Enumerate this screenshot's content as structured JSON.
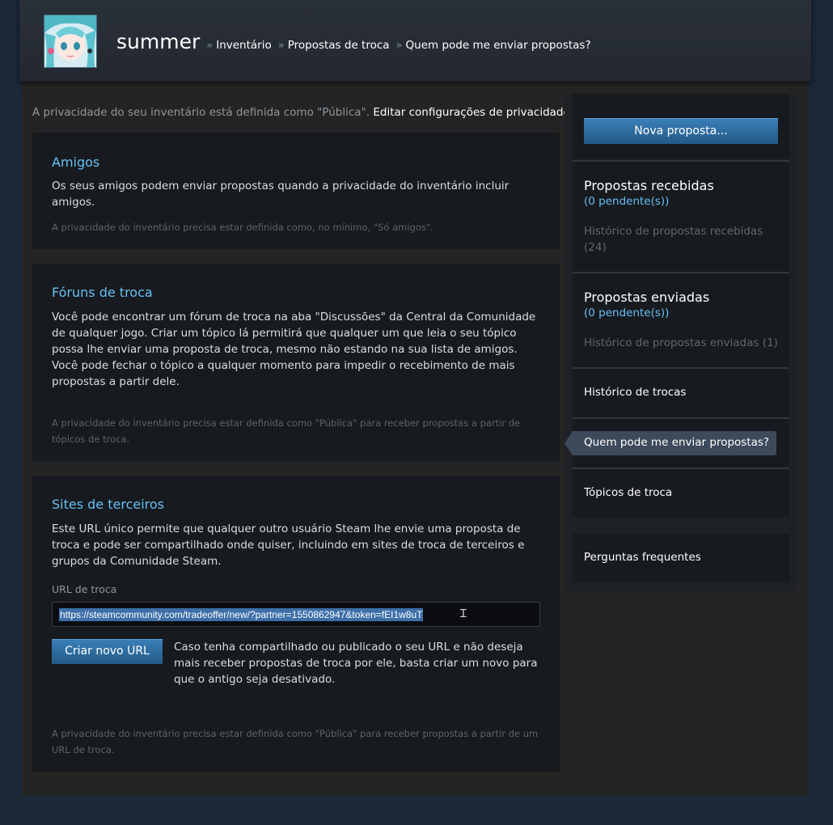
{
  "header": {
    "username": "summer",
    "breadcrumb": {
      "sep": "»",
      "items": [
        "Inventário",
        "Propostas de troca",
        "Quem pode me enviar propostas?"
      ]
    }
  },
  "privacy": {
    "text": "A privacidade do seu inventário está definida como \"Pública\".",
    "link": "Editar configurações de privacidade"
  },
  "friends": {
    "title": "Amigos",
    "text": "Os seus amigos podem enviar propostas quando a privacidade do inventário incluir amigos.",
    "note": "A privacidade do inventário precisa estar definida como, no mínimo, \"Só amigos\"."
  },
  "forums": {
    "title": "Fóruns de troca",
    "text": "Você pode encontrar um fórum de troca na aba \"Discussões\" da Central da Comunidade de qualquer jogo. Criar um tópico lá permitirá que qualquer um que leia o seu tópico possa lhe enviar uma proposta de troca, mesmo não estando na sua lista de amigos. Você pode fechar o tópico a qualquer momento para impedir o recebimento de mais propostas a partir dele.",
    "note": "A privacidade do inventário precisa estar definida como \"Pública\" para receber propostas a partir de tópicos de troca."
  },
  "third_party": {
    "title": "Sites de terceiros",
    "text": "Este URL único permite que qualquer outro usuário Steam lhe envie uma proposta de troca e pode ser compartilhado onde quiser, incluindo em sites de troca de terceiros e grupos da Comunidade Steam.",
    "url_label": "URL de troca",
    "url_value": "https://steamcommunity.com/tradeoffer/new/?partner=1550862947&token=fEI1w8uT",
    "new_url_button": "Criar novo URL",
    "new_url_desc": "Caso tenha compartilhado ou publicado o seu URL e não deseja mais receber propostas de troca por ele, basta criar um novo para que o antigo seja desativado.",
    "note": "A privacidade do inventário precisa estar definida como \"Pública\" para receber propostas a partir de um URL de troca."
  },
  "sidebar": {
    "new_offer_button": "Nova proposta...",
    "received": {
      "heading": "Propostas recebidas",
      "pending": "(0 pendente(s))",
      "history": "Histórico de propostas recebidas (24)"
    },
    "sent": {
      "heading": "Propostas enviadas",
      "pending": "(0 pendente(s))",
      "history": "Histórico de propostas enviadas (1)"
    },
    "trade_history": "Histórico de trocas",
    "who_can_send": "Quem pode me enviar propostas?",
    "trade_topics": "Tópicos de troca",
    "faq": "Perguntas frequentes"
  }
}
